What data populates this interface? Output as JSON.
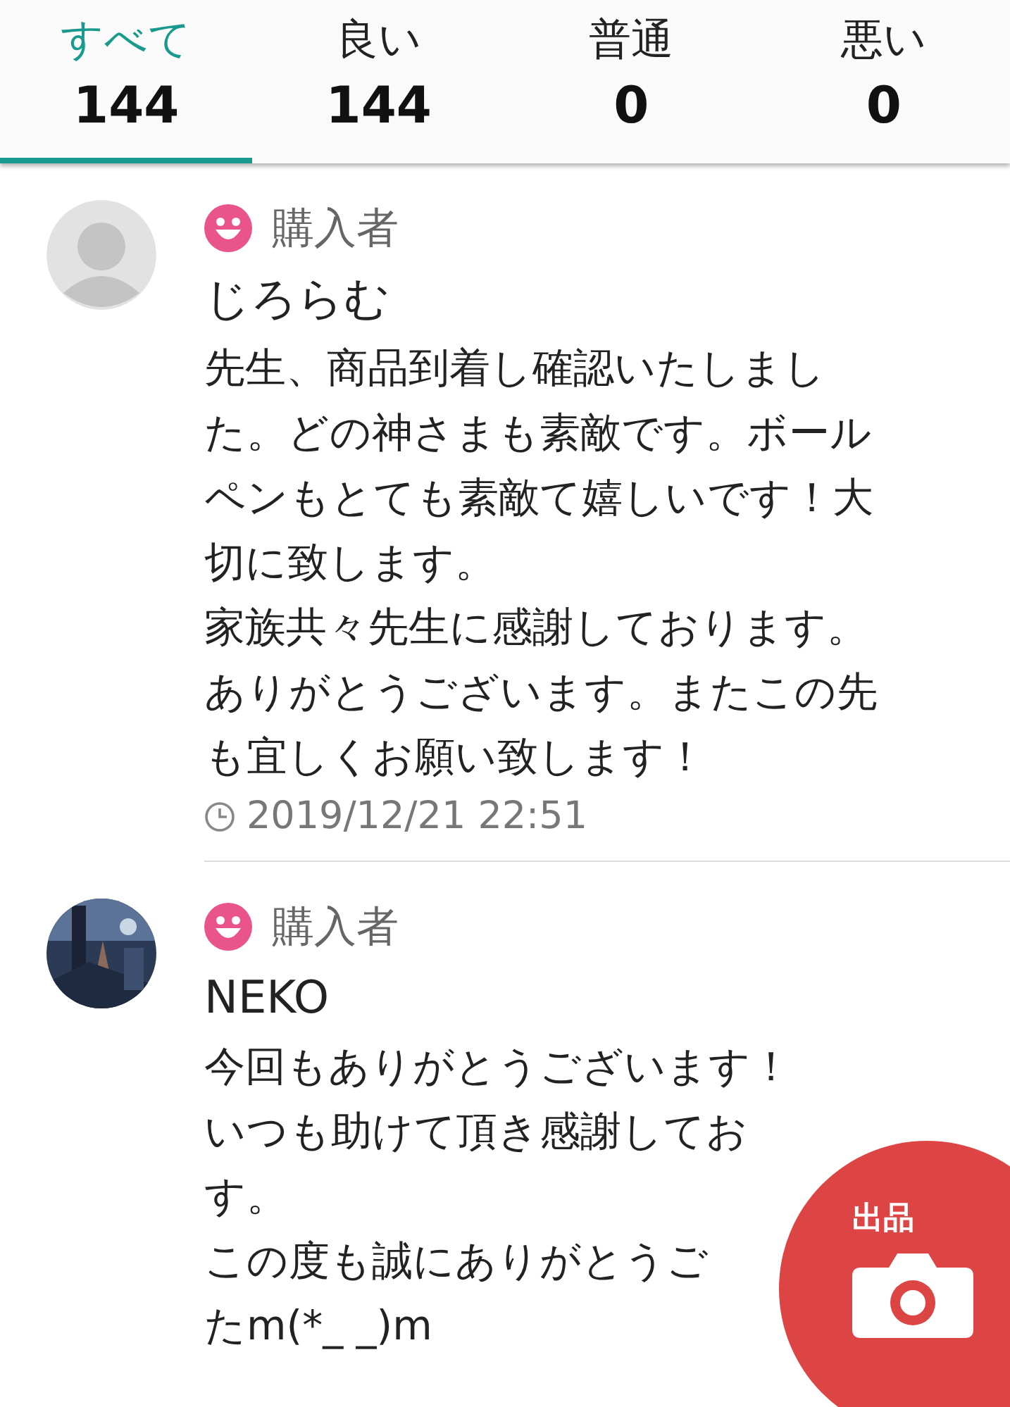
{
  "tabs": [
    {
      "label": "すべて",
      "count": "144",
      "selected": true
    },
    {
      "label": "良い",
      "count": "144",
      "selected": false
    },
    {
      "label": "普通",
      "count": "0",
      "selected": false
    },
    {
      "label": "悪い",
      "count": "0",
      "selected": false
    }
  ],
  "reviews": [
    {
      "role": "購入者",
      "name": "じろらむ",
      "photo": false,
      "lines": [
        "先生、商品到着し確認いたしまし",
        "た。どの神さまも素敵です。ボール",
        "ペンもとても素敵て嬉しいです！大",
        "切に致します。",
        "家族共々先生に感謝しております。",
        "ありがとうございます。またこの先",
        "も宜しくお願い致します！"
      ],
      "date": "2019/12/21 22:51"
    },
    {
      "role": "購入者",
      "name": "NEKO",
      "photo": true,
      "lines": [
        "今回もありがとうございます！",
        "いつも助けて頂き感謝してお",
        "す。",
        "この度も誠にありがとうご",
        "たm(*_ _)m"
      ]
    }
  ],
  "fab": {
    "label": "出品"
  }
}
